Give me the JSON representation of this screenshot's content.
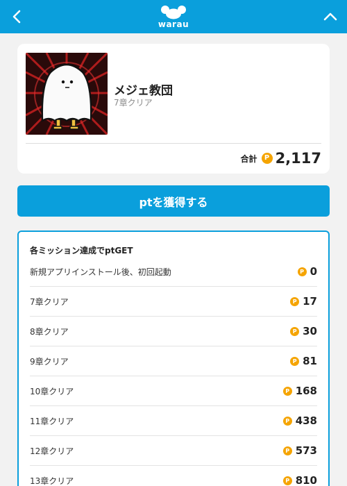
{
  "header": {
    "logo_text": "warau",
    "back_icon": "chevron-left-icon",
    "up_icon": "chevron-up-icon",
    "accent": "#0a9fdc"
  },
  "app": {
    "name": "メジェ教団",
    "status": "7章クリア"
  },
  "total": {
    "label": "合計",
    "coin_symbol": "P",
    "value": "2,117"
  },
  "cta": {
    "label": "ptを獲得する"
  },
  "missions": {
    "title": "各ミッション達成でptGET",
    "items": [
      {
        "label": "新規アプリインストール後、初回起動",
        "points": "0"
      },
      {
        "label": "7章クリア",
        "points": "17"
      },
      {
        "label": "8章クリア",
        "points": "30"
      },
      {
        "label": "9章クリア",
        "points": "81"
      },
      {
        "label": "10章クリア",
        "points": "168"
      },
      {
        "label": "11章クリア",
        "points": "438"
      },
      {
        "label": "12章クリア",
        "points": "573"
      },
      {
        "label": "13章クリア",
        "points": "810"
      }
    ]
  },
  "colors": {
    "coin": "#f5a400",
    "primary": "#0a9fdc"
  }
}
